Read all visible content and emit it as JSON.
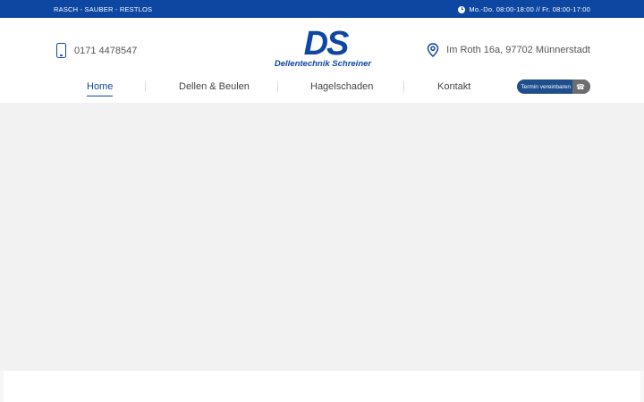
{
  "topbar": {
    "tagline": "RASCH - SAUBER - RESTLOS",
    "hours": "Mo.-Do. 08:00-18:00 // Fr. 08:00-17:00"
  },
  "contact": {
    "phone": "0171 4478547",
    "address": "Im Roth 16a, 97702 Münnerstadt"
  },
  "logo": {
    "mark": "DS",
    "text": "Dellentechnik Schreiner"
  },
  "nav": {
    "items": [
      {
        "label": "Home",
        "active": true
      },
      {
        "label": "Dellen & Beulen",
        "active": false
      },
      {
        "label": "Hagelschaden",
        "active": false
      },
      {
        "label": "Kontakt",
        "active": false
      }
    ],
    "cta_label": "Termin vereinbaren"
  },
  "colors": {
    "brand_blue": "#0d47a1",
    "cta_blue": "#1e4f8c",
    "cta_gray": "#6d6d6d"
  },
  "icons": {
    "hours": "clock-icon",
    "phone": "smartphone-icon",
    "address": "map-pin-icon",
    "cta": "phone-icon"
  }
}
